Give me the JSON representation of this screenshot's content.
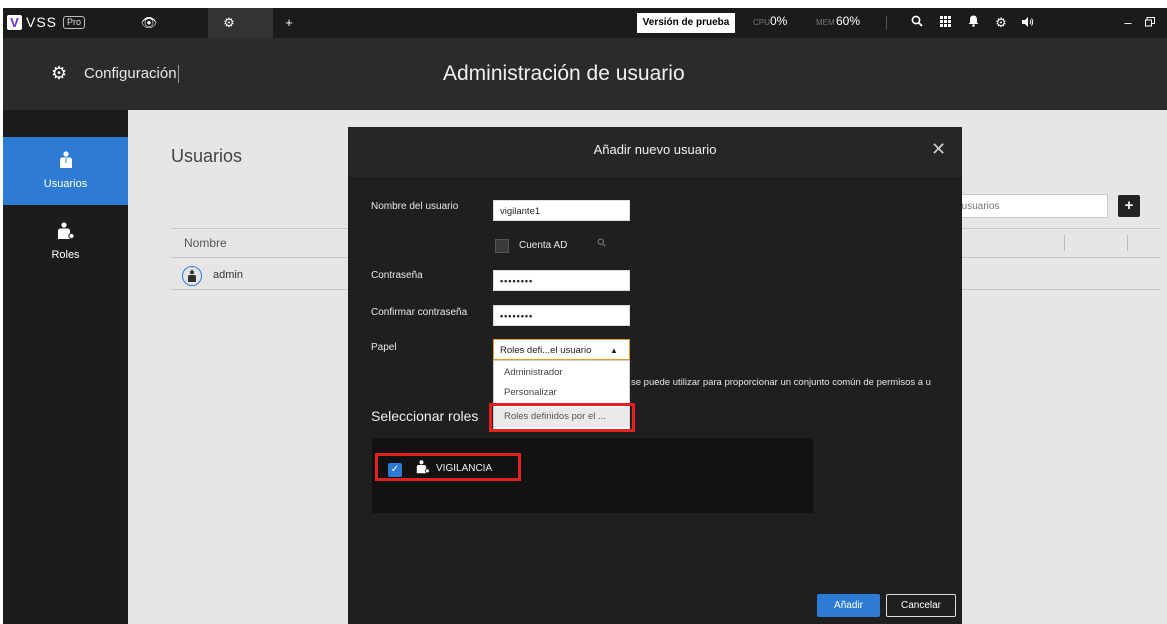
{
  "topbar": {
    "logo_text": "VSS",
    "pro_badge": "Pro",
    "trial_button": "Versión de prueba",
    "cpu_label": "CPU",
    "cpu_value": "0%",
    "mem_label": "MEM",
    "mem_value": "60%",
    "icons": [
      "eye-icon",
      "gear-icon",
      "plus-icon",
      "search-icon",
      "grid-icon",
      "bell-icon",
      "gear-icon",
      "speaker-icon",
      "minimize-icon",
      "window-icon"
    ]
  },
  "header": {
    "section_label": "Configuración",
    "page_title": "Administración de usuario"
  },
  "sidebar": {
    "items": [
      {
        "label": "Usuarios",
        "icon": "user-icon",
        "active": true
      },
      {
        "label": "Roles",
        "icon": "user-settings-icon",
        "active": false
      }
    ]
  },
  "main": {
    "title": "Usuarios",
    "search_placeholder": "car usuarios",
    "add_button": "+",
    "columns": [
      "Nombre"
    ],
    "rows": [
      {
        "name": "admin"
      }
    ]
  },
  "modal": {
    "title": "Añadir nuevo usuario",
    "fields": {
      "username_label": "Nombre del usuario",
      "username_value": "vigilante1",
      "ad_label": "Cuenta AD",
      "password_label": "Contraseña",
      "password_value": "••••••••",
      "confirm_label": "Confirmar contraseña",
      "confirm_value": "••••••••",
      "role_label": "Papel",
      "role_selected": "Roles defi...el usuario"
    },
    "dropdown_options": [
      "Administrador",
      "Personalizar",
      "Roles definidos por el ..."
    ],
    "description": "se puede utilizar para proporcionar un conjunto común de permisos a u",
    "select_roles_label": "Seleccionar roles",
    "roles": [
      {
        "name": "VIGILANCIA",
        "checked": true
      }
    ],
    "add_button": "Añadir",
    "cancel_button": "Cancelar"
  },
  "colors": {
    "accent": "#2e7bd6",
    "highlight": "#e52020",
    "dark_bg": "#1f1f1f"
  }
}
